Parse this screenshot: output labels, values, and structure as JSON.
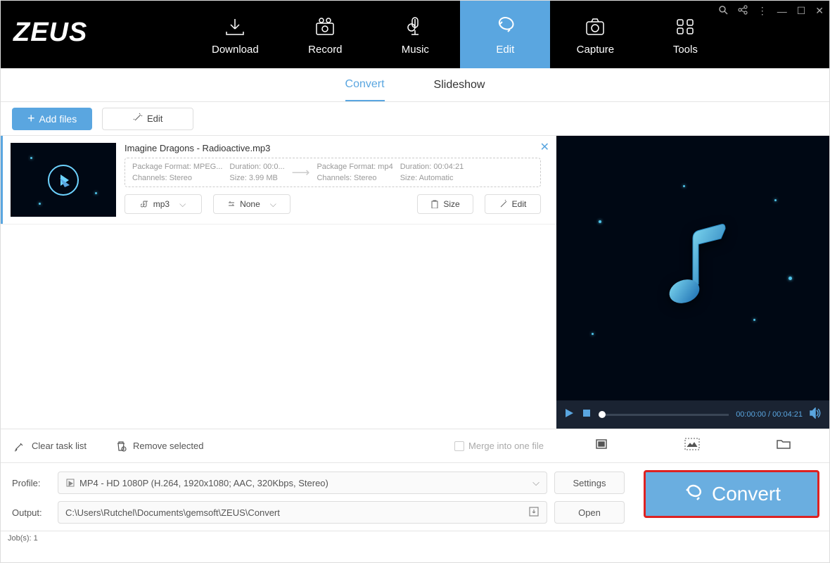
{
  "app": {
    "name": "ZEUS",
    "jobs": "Job(s): 1"
  },
  "nav": {
    "download": "Download",
    "record": "Record",
    "music": "Music",
    "edit": "Edit",
    "capture": "Capture",
    "tools": "Tools"
  },
  "subtabs": {
    "convert": "Convert",
    "slideshow": "Slideshow"
  },
  "toolbar": {
    "add": "Add files",
    "edit": "Edit"
  },
  "file": {
    "name": "Imagine Dragons - Radioactive.mp3",
    "src": {
      "pkg": "Package Format: MPEG...",
      "dur": "Duration:  00:0...",
      "ch": "Channels: Stereo",
      "size": "Size: 3.99 MB"
    },
    "dst": {
      "pkg": "Package Format: mp4",
      "dur": "Duration: 00:04:21",
      "ch": "Channels: Stereo",
      "size": "Size: Automatic"
    },
    "actions": {
      "format": "mp3",
      "effect": "None",
      "size": "Size",
      "edit": "Edit"
    }
  },
  "listActions": {
    "clear": "Clear task list",
    "remove": "Remove selected",
    "merge": "Merge into one file"
  },
  "player": {
    "time": "00:00:00 / 00:04:21"
  },
  "bottom": {
    "profileLabel": "Profile:",
    "profile": "MP4 - HD 1080P (H.264, 1920x1080; AAC, 320Kbps, Stereo)",
    "outputLabel": "Output:",
    "output": "C:\\Users\\Rutchel\\Documents\\gemsoft\\ZEUS\\Convert",
    "settings": "Settings",
    "open": "Open",
    "convert": "Convert"
  }
}
